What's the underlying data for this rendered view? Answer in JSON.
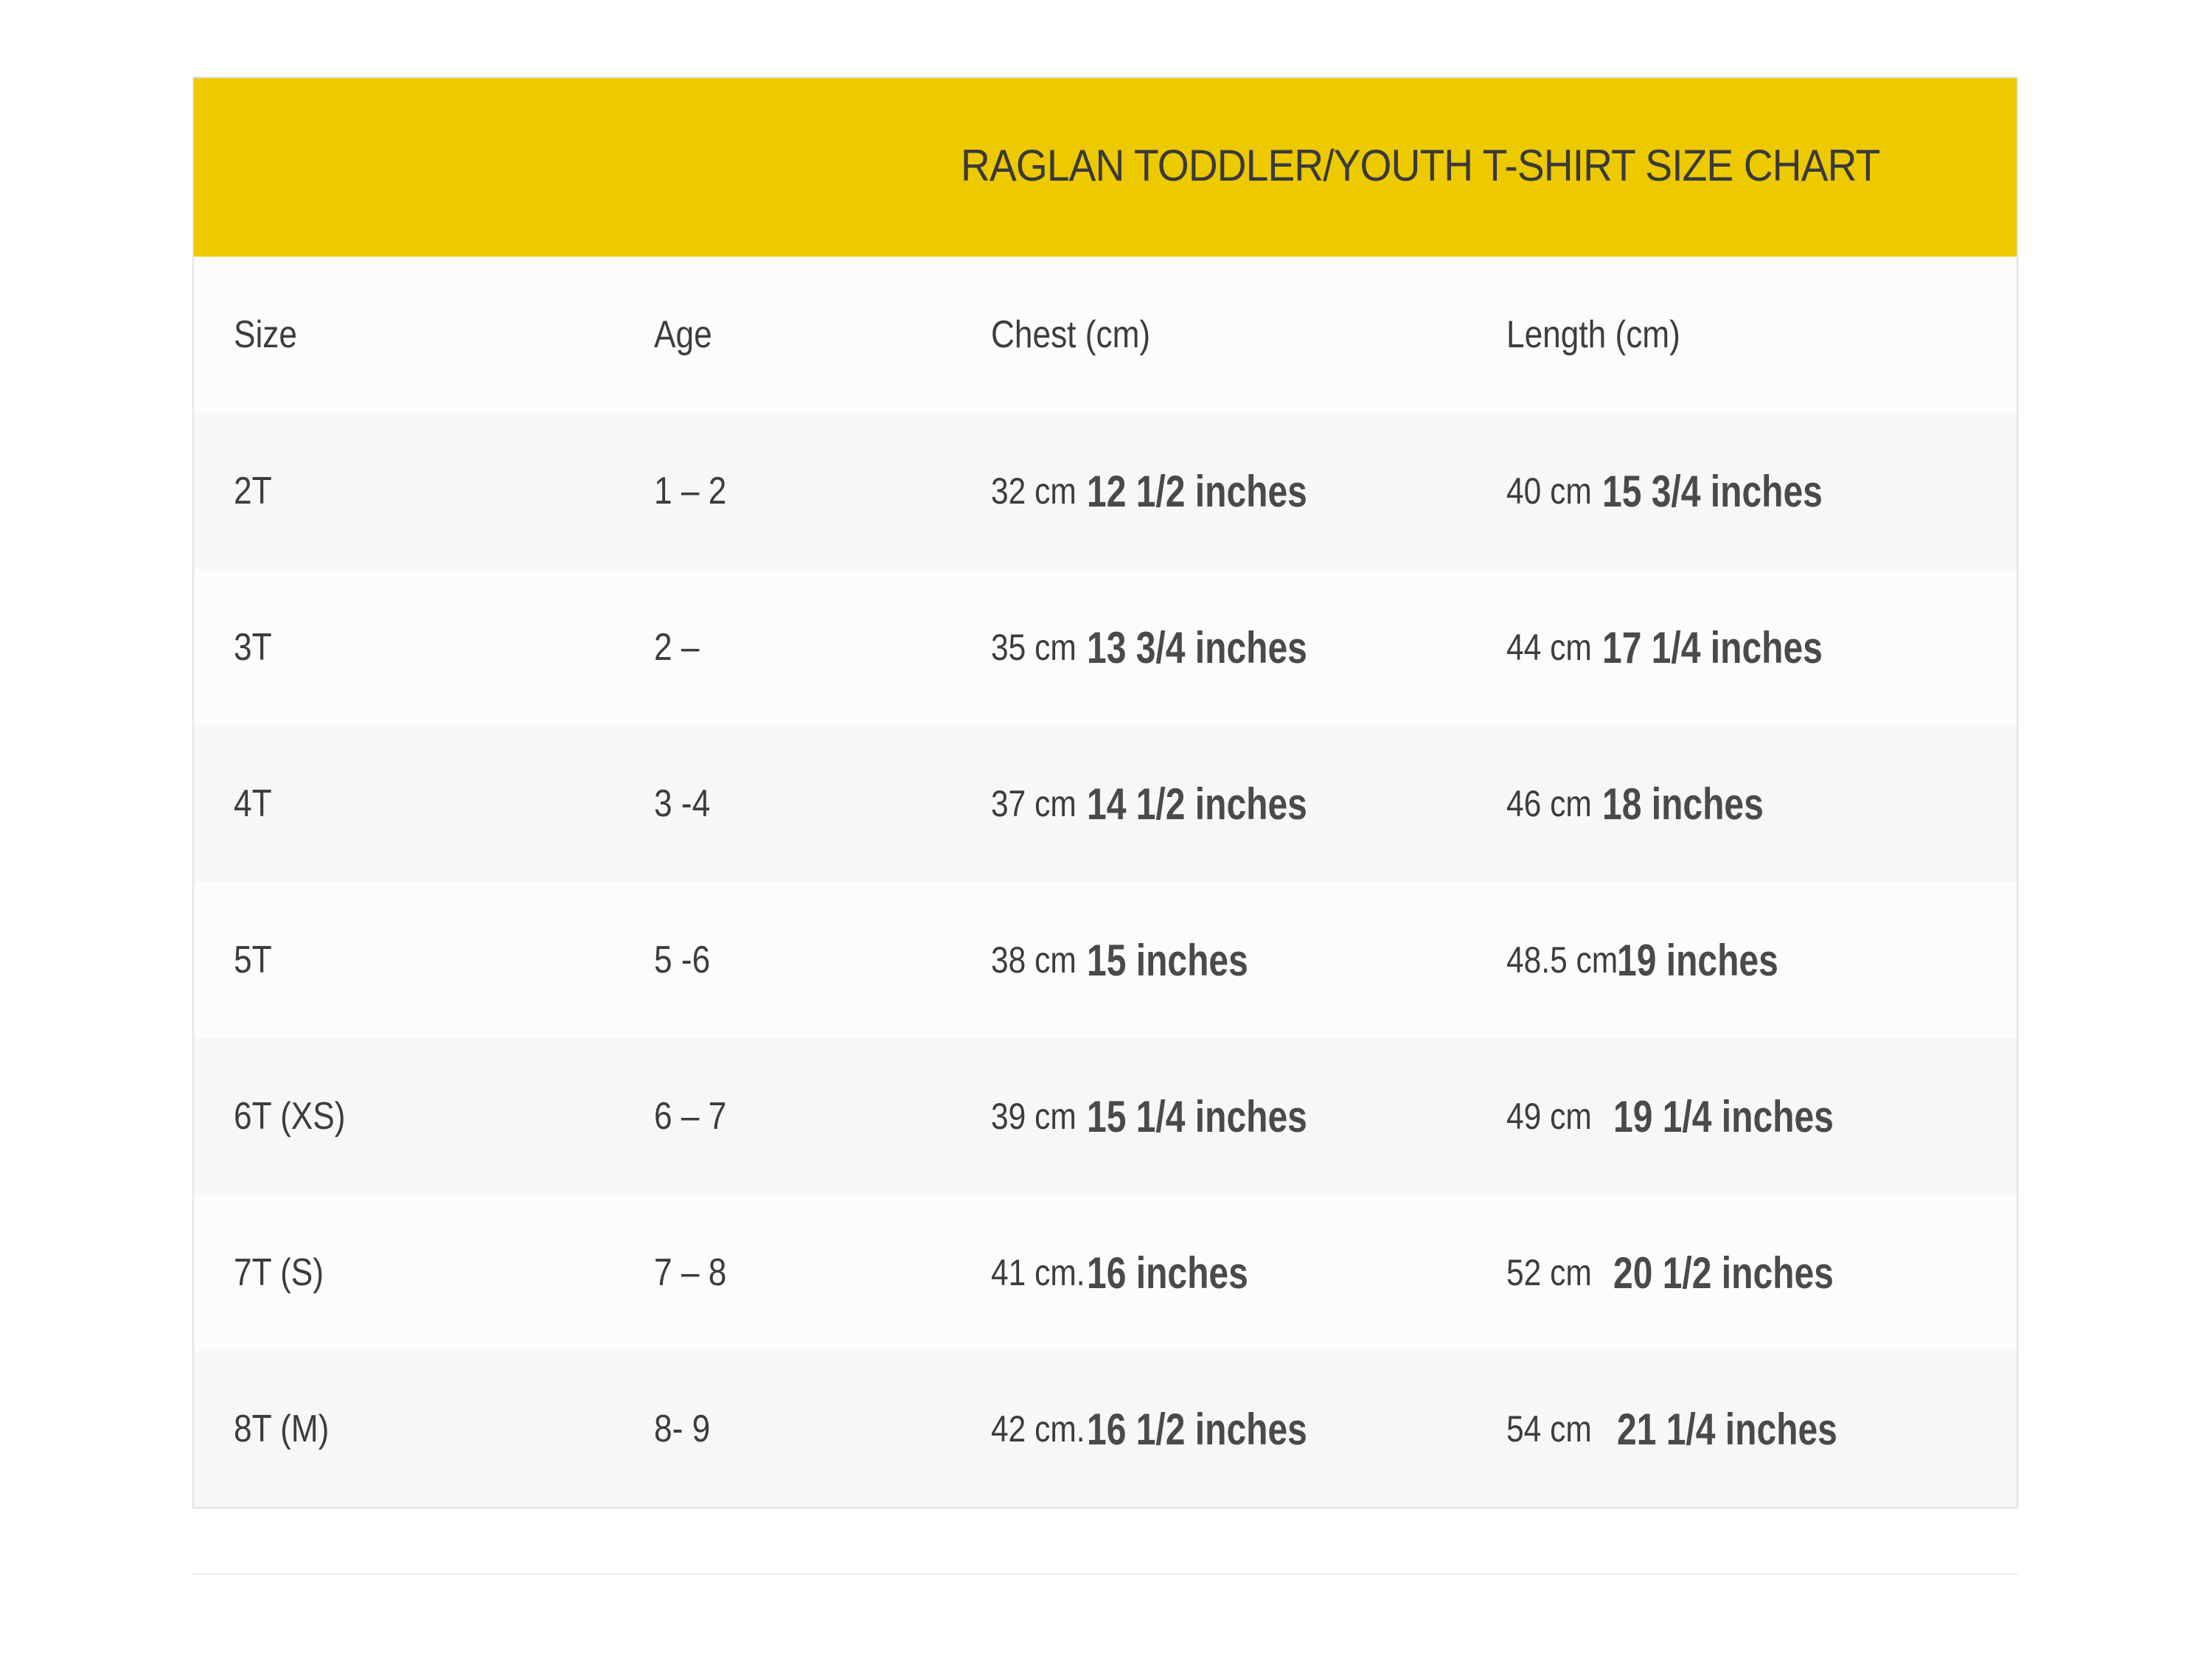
{
  "title": "RAGLAN TODDLER/YOUTH T-SHIRT SIZE CHART",
  "colors": {
    "header_band": "#edc900",
    "text": "#3d3d3d"
  },
  "columns": [
    "Size",
    "Age",
    "Chest (cm)",
    "Length (cm)"
  ],
  "rows": [
    {
      "size": "2T",
      "age": "1 – 2",
      "chest_cm": "32 cm",
      "chest_in": "12 1/2 inches",
      "length_cm": "40 cm",
      "length_in": "15 3/4 inches"
    },
    {
      "size": "3T",
      "age": "2 –",
      "chest_cm": "35 cm",
      "chest_in": "13 3/4 inches",
      "length_cm": "44 cm",
      "length_in": "17 1/4 inches"
    },
    {
      "size": "4T",
      "age": "3 -4",
      "chest_cm": "37 cm",
      "chest_in": "14 1/2 inches",
      "length_cm": "46 cm",
      "length_in": "18 inches"
    },
    {
      "size": "5T",
      "age": "5 -6",
      "chest_cm": "38 cm",
      "chest_in": "15 inches",
      "length_cm": "48.5 cm",
      "length_in": "19 inches"
    },
    {
      "size": "6T (XS)",
      "age": "6 – 7",
      "chest_cm": "39 cm",
      "chest_in": "15 1/4 inches",
      "length_cm": "49 cm",
      "length_in": "19 1/4 inches"
    },
    {
      "size": "7T (S)",
      "age": "7 – 8",
      "chest_cm": "41 cm.",
      "chest_in": "16 inches",
      "length_cm": "52 cm",
      "length_in": "20 1/2 inches"
    },
    {
      "size": "8T (M)",
      "age": "8- 9",
      "chest_cm": "42 cm.",
      "chest_in": "16 1/2 inches",
      "length_cm": "54 cm",
      "length_in": "21 1/4 inches"
    }
  ]
}
